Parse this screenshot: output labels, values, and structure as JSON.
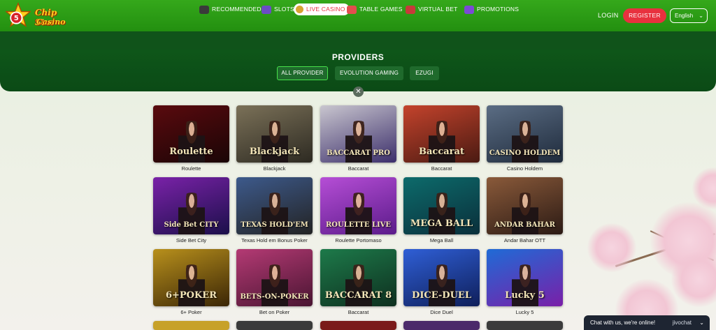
{
  "brand": {
    "line1": "Chip Star",
    "line2": "Casino",
    "coin_glyph": "5"
  },
  "header": {
    "login": "LOGIN",
    "register": "REGISTER",
    "language": "English",
    "language_chevron": "⌄"
  },
  "nav": [
    {
      "label": "RECOMMENDED",
      "icon": "controller-icon",
      "color": "#3a3a3a"
    },
    {
      "label": "SLOTS",
      "icon": "slot-machine-icon",
      "color": "#6b4cc4"
    },
    {
      "label": "LIVE CASINO",
      "icon": "chip-icon",
      "color": "#d7a331",
      "active": true
    },
    {
      "label": "TABLE GAMES",
      "icon": "dice-icon",
      "color": "#e24e4e"
    },
    {
      "label": "VIRTUAL BET",
      "icon": "racing-icon",
      "color": "#c83a3a"
    },
    {
      "label": "PROMOTIONS",
      "icon": "gift-icon",
      "color": "#7b4ad6"
    }
  ],
  "providers": {
    "title": "PROVIDERS",
    "items": [
      {
        "label": "ALL PROVIDER",
        "active": true
      },
      {
        "label": "EVOLUTION GAMING"
      },
      {
        "label": "EZUGI"
      }
    ],
    "close_glyph": "✕"
  },
  "games": [
    {
      "name": "Roulette",
      "thumb_text": "Roulette",
      "bg": [
        "#5a0a0e",
        "#1a0506"
      ]
    },
    {
      "name": "Blackjack",
      "thumb_text": "Blackjack",
      "bg": [
        "#7b7158",
        "#2d2a22"
      ]
    },
    {
      "name": "Baccarat",
      "thumb_text": "BACCARAT PRO",
      "bg": [
        "#c9c6cf",
        "#3c2f6b"
      ]
    },
    {
      "name": "Baccarat",
      "thumb_text": "Baccarat",
      "bg": [
        "#c4432c",
        "#4a1a12"
      ]
    },
    {
      "name": "Casino Holdem",
      "thumb_text": "CASINO HOLDEM",
      "bg": [
        "#5b6d84",
        "#1f2b3c"
      ]
    },
    {
      "name": "Side Bet City",
      "thumb_text": "Side Bet CITY",
      "bg": [
        "#7a22a8",
        "#1b0f4a"
      ]
    },
    {
      "name": "Texas Hold em Bonus Poker",
      "thumb_text": "TEXAS HOLD'EM",
      "bg": [
        "#3d5a8c",
        "#232323"
      ]
    },
    {
      "name": "Roulette Portomaso",
      "thumb_text": "ROULETTE LIVE",
      "bg": [
        "#b64ed6",
        "#5b1b8a"
      ]
    },
    {
      "name": "Mega Ball",
      "thumb_text": "MEGA BALL",
      "bg": [
        "#0d6b6b",
        "#0a2f3b"
      ]
    },
    {
      "name": "Andar Bahar OTT",
      "thumb_text": "ANDAR BAHAR",
      "bg": [
        "#8a5a3a",
        "#2b1a14"
      ]
    },
    {
      "name": "6+ Poker",
      "thumb_text": "6+POKER",
      "bg": [
        "#b8901c",
        "#3b2606"
      ]
    },
    {
      "name": "Bet on Poker",
      "thumb_text": "BETS-ON-POKER",
      "bg": [
        "#b43a74",
        "#4a1532"
      ]
    },
    {
      "name": "Baccarat",
      "thumb_text": "BACCARAT 8",
      "bg": [
        "#1d7a4a",
        "#0e2f1f"
      ]
    },
    {
      "name": "Dice Duel",
      "thumb_text": "DICE-DUEL",
      "bg": [
        "#2f5fd6",
        "#0f1f5a"
      ]
    },
    {
      "name": "Lucky 5",
      "thumb_text": "Lucky 5",
      "bg": [
        "#1f6bd6",
        "#7a1fa8"
      ]
    }
  ],
  "more_row_colors": [
    "#c7a129",
    "#3a3a3a",
    "#7a1a1a",
    "#4b2a6a",
    "#3b3b3b"
  ],
  "chat": {
    "label": "Chat with us, we're online!",
    "brand": "jivochat",
    "chevron": "⌄"
  }
}
